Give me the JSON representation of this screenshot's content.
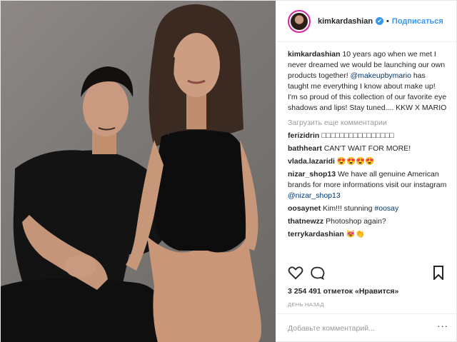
{
  "header": {
    "username": "kimkardashian",
    "verified_mark": "✔",
    "separator": "•",
    "follow_label": "Подписаться"
  },
  "caption": {
    "username": "kimkardashian",
    "text_a": " 10 years ago when we met I never dreamed we would be launching our own products together! ",
    "mention": "@makeupbymario",
    "text_b": " has taught me everything I know about make up! I'm so proud of this collection of our favorite eye shadows and lips! Stay tuned.... KKW X MARIO"
  },
  "load_more_label": "Загрузить еще комментарии",
  "comments": [
    {
      "user": "ferizidrin",
      "text": " □□□□□□□□□□□□□□□□"
    },
    {
      "user": "bathheart",
      "text": " CAN'T WAIT FOR MORE!"
    },
    {
      "user": "vlada.lazaridi",
      "text": " 😍😍😍😍"
    },
    {
      "user": "nizar_shop13",
      "text": " We have all genuine American brands for more informations visit our instagram ",
      "link": "@nizar_shop13"
    },
    {
      "user": "oosaynet",
      "text": " Kim!!! stunning ",
      "link": "#oosay"
    },
    {
      "user": "thatnewzz",
      "text": " Photoshop again?"
    },
    {
      "user": "terrykardashian",
      "text": " 😻👏"
    }
  ],
  "actions": {
    "like_icon": "heart-icon",
    "comment_icon": "comment-icon",
    "save_icon": "bookmark-icon"
  },
  "likes_text": "3 254 491 отметок «Нравится»",
  "time_text": "ДЕНЬ НАЗАД",
  "add_comment": {
    "placeholder": "Добавьте комментарий...",
    "options_label": "···"
  }
}
